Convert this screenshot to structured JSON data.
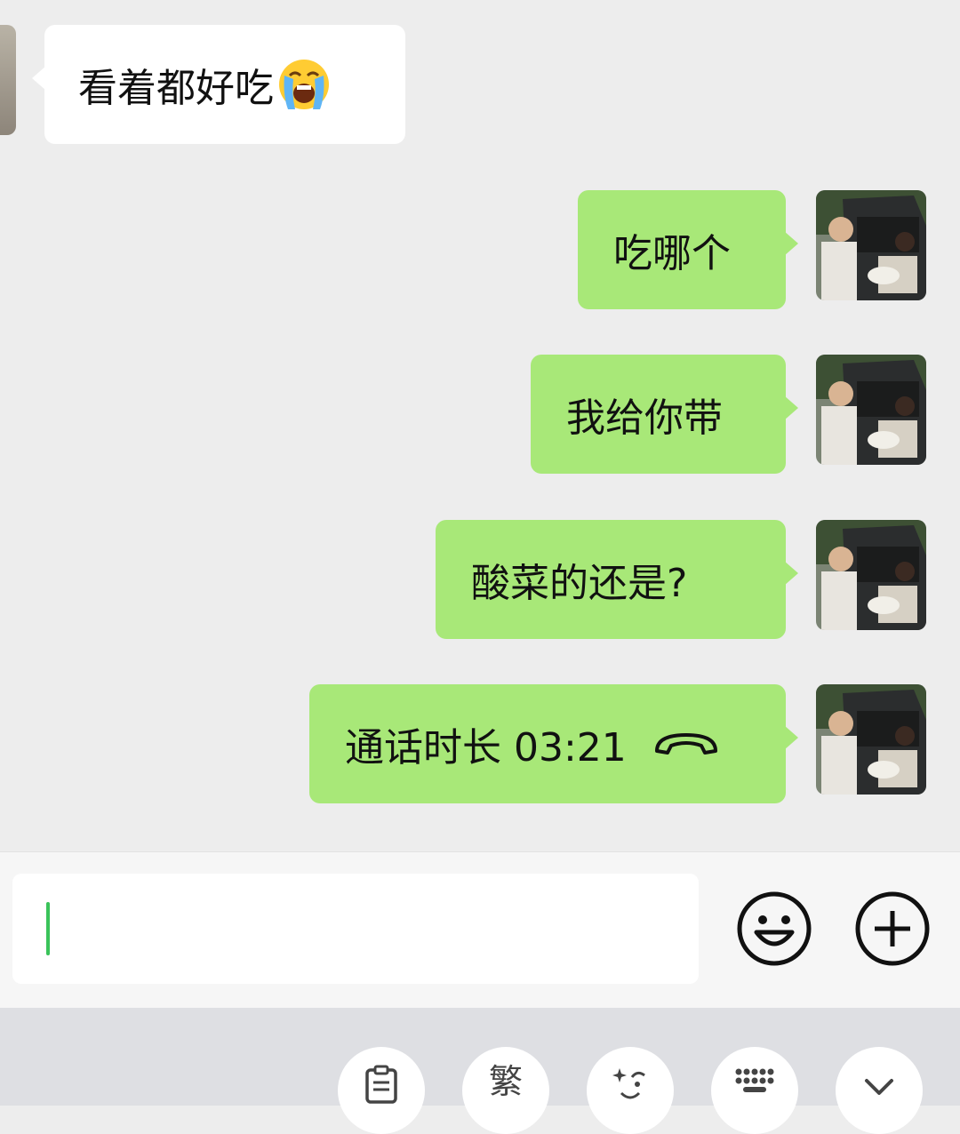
{
  "messages": [
    {
      "side": "incoming",
      "text": "看着都好吃",
      "emoji": "loudly-crying-face-emoji"
    },
    {
      "side": "outgoing",
      "text": "吃哪个"
    },
    {
      "side": "outgoing",
      "text": "我给你带"
    },
    {
      "side": "outgoing",
      "text": "酸菜的还是?"
    },
    {
      "side": "outgoing",
      "text": "通话时长 03:21",
      "icon": "phone-hangup-icon"
    }
  ],
  "input": {
    "value": ""
  },
  "input_bar": {
    "emoji_button_icon": "smiley-face-icon",
    "more_button_icon": "plus-circle-icon"
  },
  "keyboard_toolbar": [
    {
      "icon": "clipboard-icon",
      "label": ""
    },
    {
      "icon": "traditional-chinese-toggle",
      "label": "繁"
    },
    {
      "icon": "face-emoji-icon",
      "label": ""
    },
    {
      "icon": "keyboard-grid-icon",
      "label": ""
    },
    {
      "icon": "chevron-down-icon",
      "label": ""
    }
  ],
  "colors": {
    "outgoing_bubble": "#a8e878",
    "incoming_bubble": "#ffffff",
    "chat_background": "#ededed",
    "caret": "#3ac35a"
  }
}
